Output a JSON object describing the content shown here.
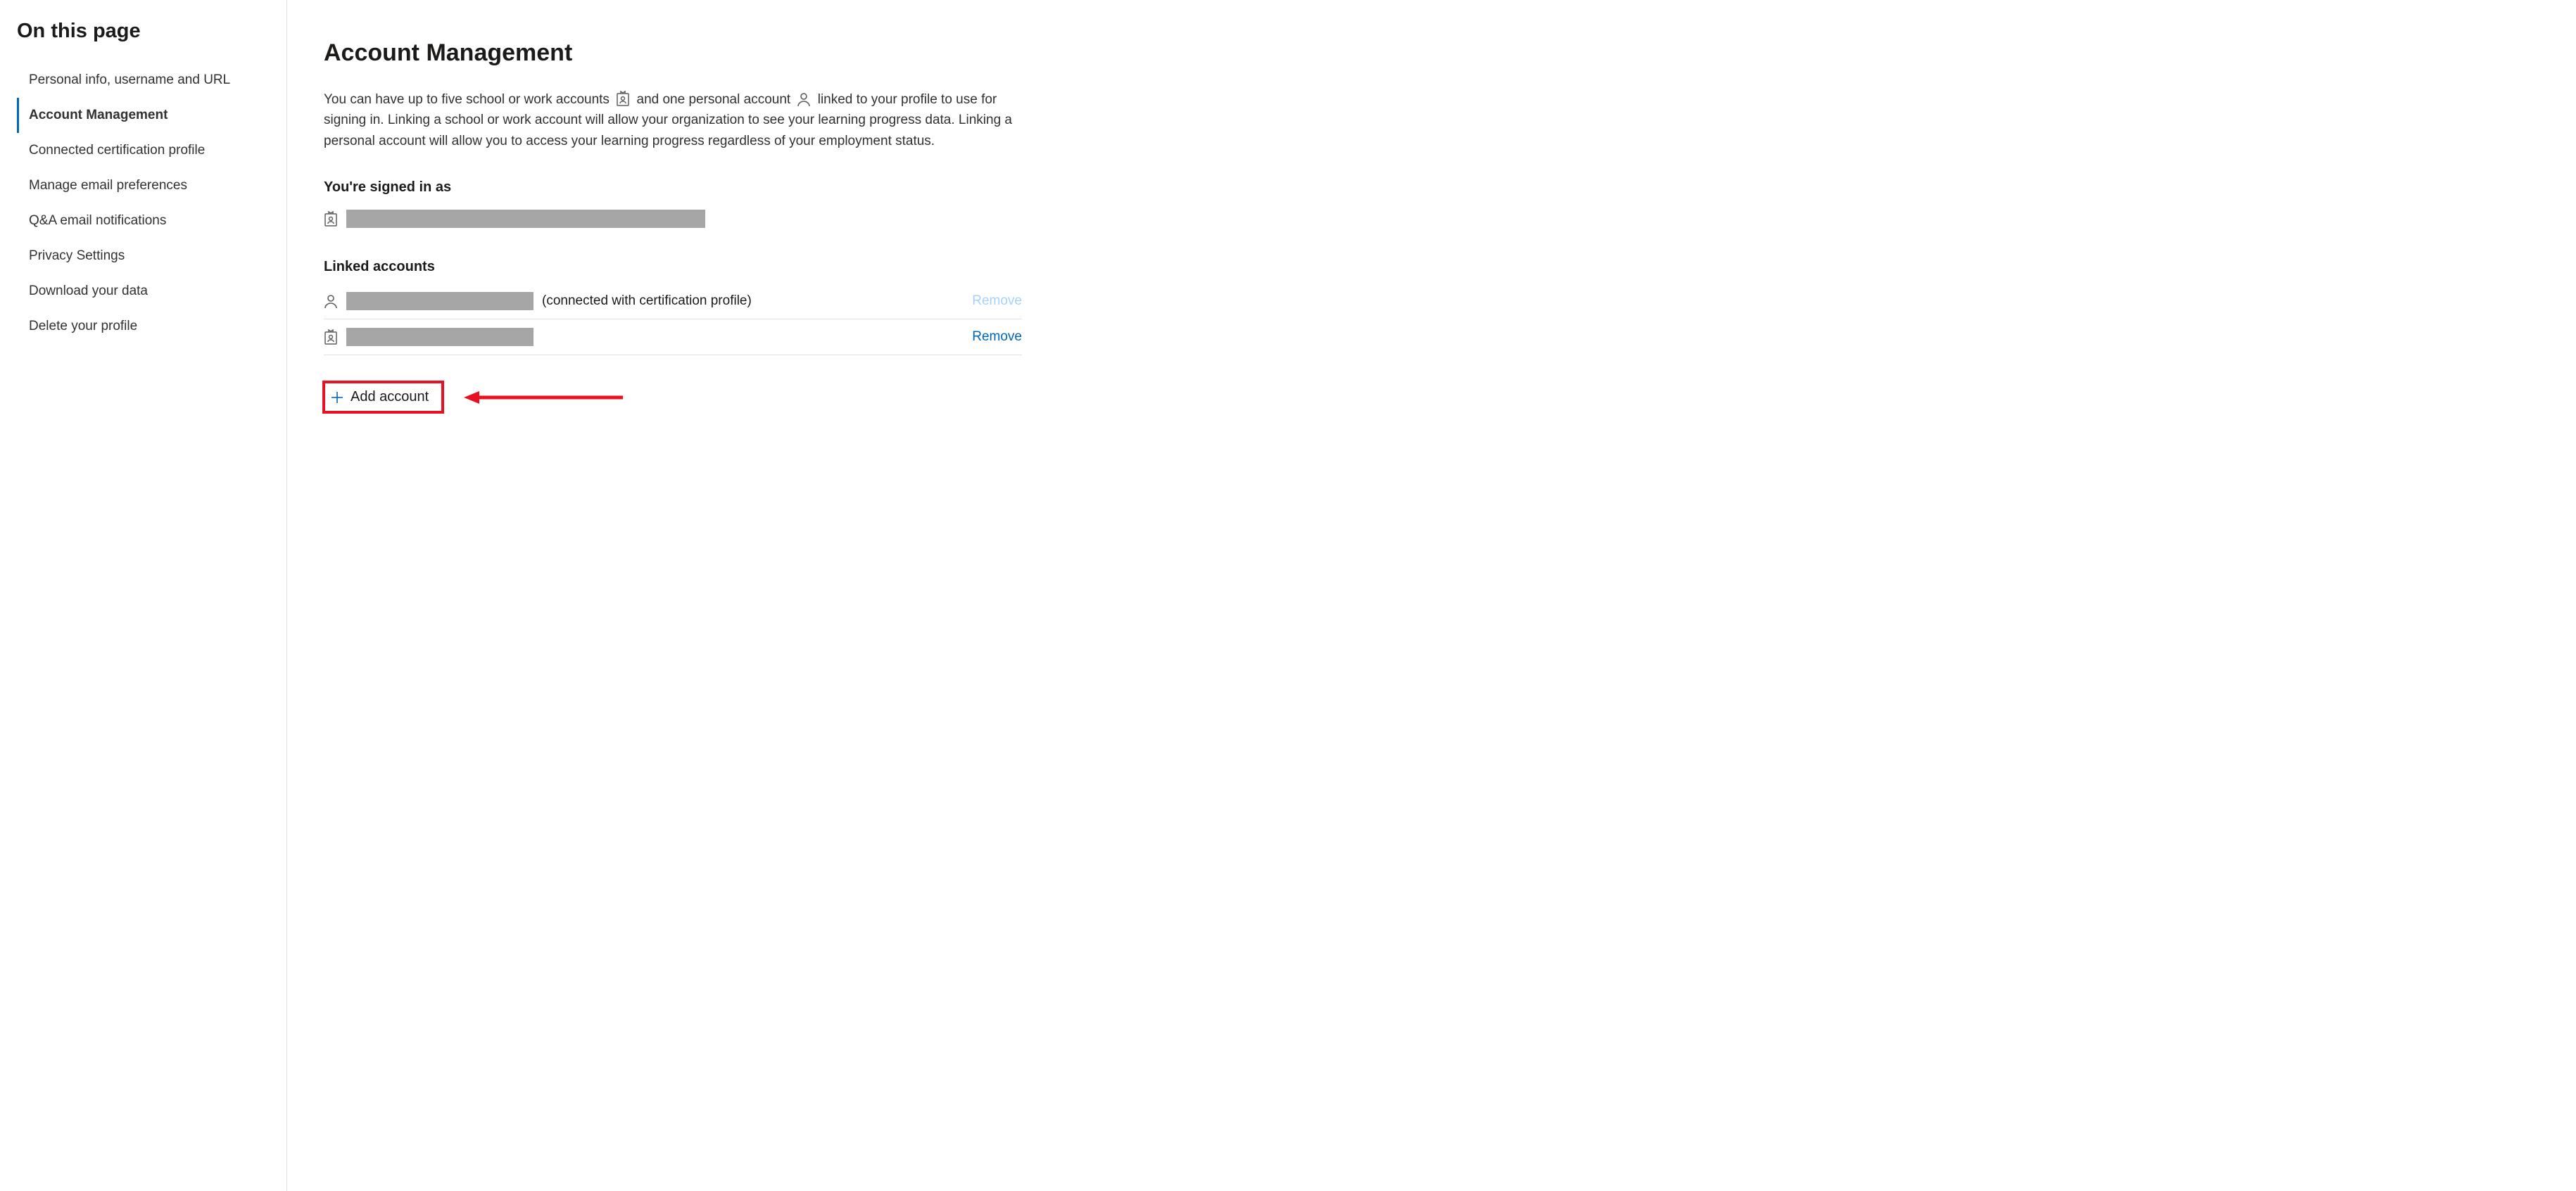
{
  "sidebar": {
    "title": "On this page",
    "items": [
      {
        "label": "Personal info, username and URL"
      },
      {
        "label": "Account Management"
      },
      {
        "label": "Connected certification profile"
      },
      {
        "label": "Manage email preferences"
      },
      {
        "label": "Q&A email notifications"
      },
      {
        "label": "Privacy Settings"
      },
      {
        "label": "Download your data"
      },
      {
        "label": "Delete your profile"
      }
    ],
    "active_index": 1
  },
  "main": {
    "title": "Account Management",
    "description_parts": {
      "p1": "You can have up to five school or work accounts",
      "p2": "and one personal account",
      "p3": "linked to your profile to use for signing in. Linking a school or work account will allow your organization to see your learning progress data. Linking a personal account will allow you to access your learning progress regardless of your employment status."
    },
    "signed_in_heading": "You're signed in as",
    "signed_in_account": {
      "type": "work",
      "redacted": true
    },
    "linked_heading": "Linked accounts",
    "linked_accounts": [
      {
        "type": "personal",
        "redacted": true,
        "note": "(connected with certification profile)",
        "remove_label": "Remove",
        "remove_enabled": false
      },
      {
        "type": "work",
        "redacted": true,
        "note": "",
        "remove_label": "Remove",
        "remove_enabled": true
      }
    ],
    "add_account_label": "Add account"
  },
  "colors": {
    "accent": "#0067b8",
    "annotation": "#e81123"
  }
}
